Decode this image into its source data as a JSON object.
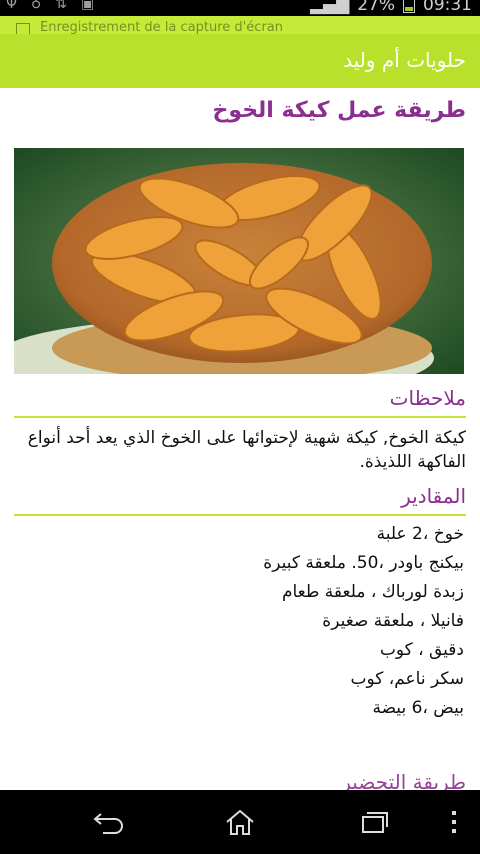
{
  "status_bar": {
    "battery_percent": "27%",
    "time": "09:31",
    "icons": [
      "usb-icon",
      "location-icon",
      "wifi-data-icon",
      "image-icon",
      "signal-icon",
      "battery-icon"
    ]
  },
  "notification": {
    "text": "Enregistrement de la capture d'écran"
  },
  "app_bar": {
    "title": "حلويات أم وليد"
  },
  "article": {
    "title": "طريقة عمل كيكة الخوخ",
    "image_alt": "peach cake photo",
    "notes_heading": "ملاحظات",
    "notes_text": "كيكة الخوخ, كيكة شهية لإحتوائها على الخوخ الذي يعد أحد أنواع الفاكهة اللذيذة.",
    "ingredients_heading": "المقادير",
    "ingredients": [
      "خوخ ،2 علبة",
      "بيكنج باودر ،50. ملعقة كبيرة",
      "زبدة لورباك ، ملعقة طعام",
      "فانيلا ، ملعقة صغيرة",
      "دقيق ، كوب",
      "سكر ناعم، كوب",
      "بيض ،6 بيضة"
    ],
    "next_heading": "طريقة التحضير"
  },
  "nav_bar": {
    "buttons": [
      "back-icon",
      "home-icon",
      "recent-apps-icon",
      "overflow-menu-icon"
    ]
  },
  "colors": {
    "app_bar": "#b9e12b",
    "accent_purple": "#8a2f8f",
    "divider_green": "#bfe43a"
  }
}
